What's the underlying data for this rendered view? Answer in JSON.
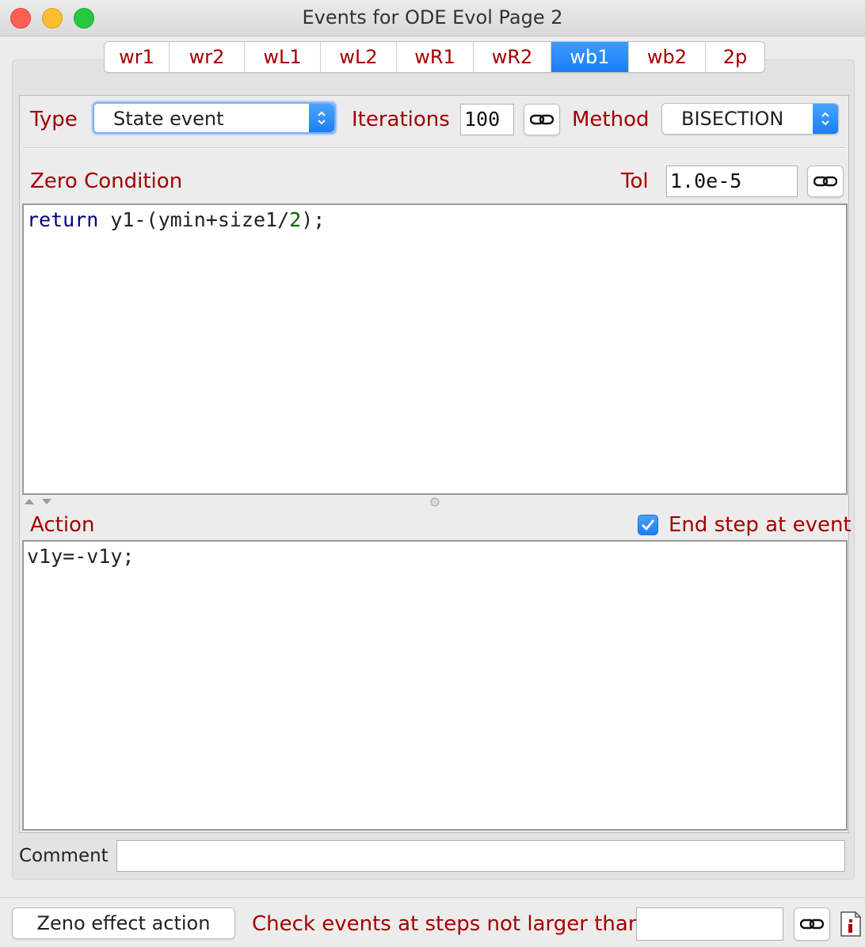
{
  "window": {
    "title": "Events for ODE Evol Page 2"
  },
  "tabs": [
    {
      "label": "wr1",
      "active": false
    },
    {
      "label": "wr2",
      "active": false
    },
    {
      "label": "wL1",
      "active": false
    },
    {
      "label": "wL2",
      "active": false
    },
    {
      "label": "wR1",
      "active": false
    },
    {
      "label": "wR2",
      "active": false
    },
    {
      "label": "wb1",
      "active": true
    },
    {
      "label": "wb2",
      "active": false
    },
    {
      "label": "2p",
      "active": false
    }
  ],
  "event": {
    "type_label": "Type",
    "type_value": "State event",
    "iterations_label": "Iterations",
    "iterations_value": "100",
    "method_label": "Method",
    "method_value": "BISECTION",
    "zero_condition_label": "Zero Condition",
    "tol_label": "Tol",
    "tol_value": "1.0e-5",
    "zero_code": {
      "keyword": "return",
      "pre": " y1-(ymin+size1/",
      "number": "2",
      "post": ");"
    },
    "action_label": "Action",
    "end_step_label": "End step at event",
    "end_step_checked": true,
    "action_code": "v1y=-v1y;",
    "comment_label": "Comment",
    "comment_value": ""
  },
  "footer": {
    "zeno_button": "Zeno effect action",
    "check_label": "Check events at steps not larger than",
    "check_value": ""
  },
  "colors": {
    "label_red": "#a40000",
    "accent_blue": "#1a7ff5",
    "keyword_blue": "#000080",
    "number_green": "#006400"
  }
}
